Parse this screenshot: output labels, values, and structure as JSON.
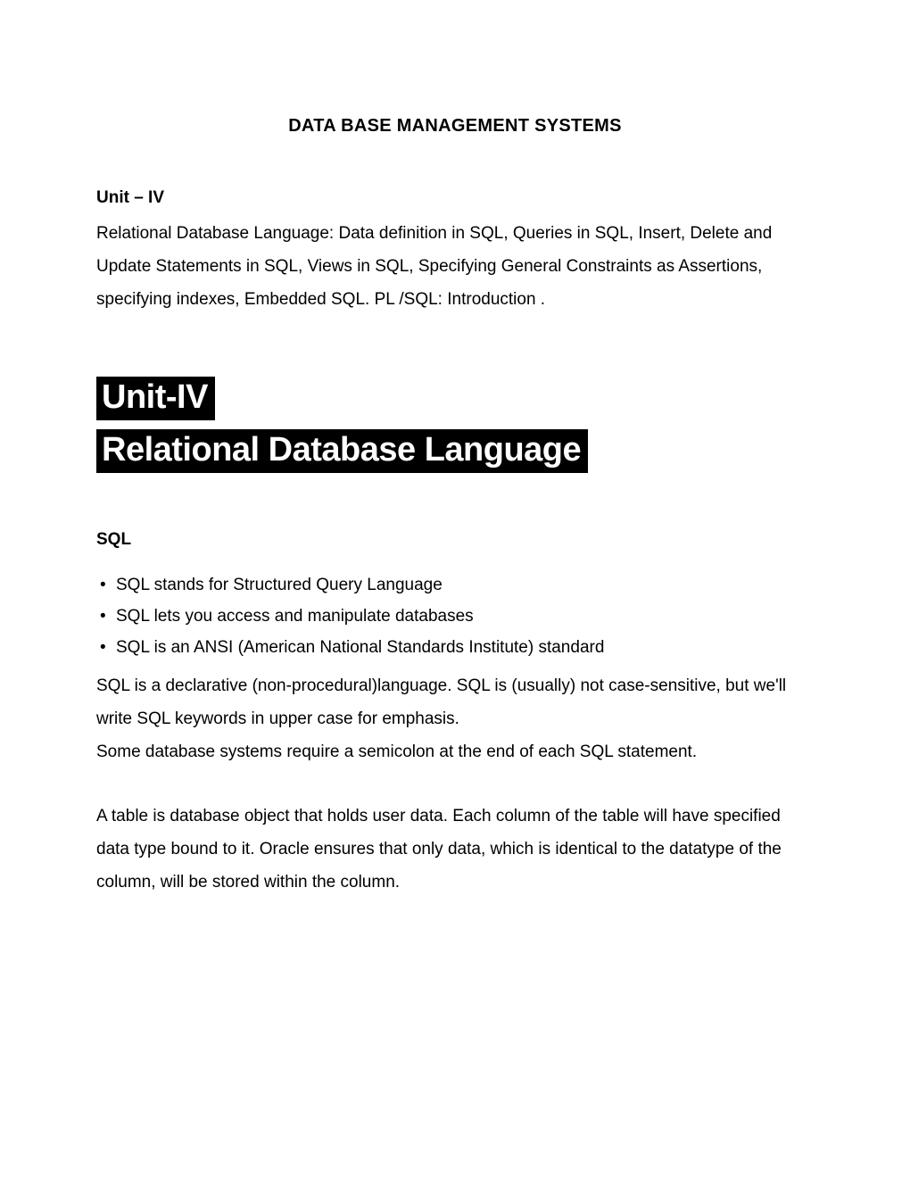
{
  "title": "DATA BASE MANAGEMENT SYSTEMS",
  "unit_label": "Unit – IV",
  "syllabus": "Relational Database Language: Data definition in SQL, Queries in SQL, Insert, Delete and Update Statements in SQL, Views in SQL, Specifying General Constraints as Assertions, specifying indexes, Embedded SQL. PL /SQL: Introduction .",
  "heading1": "Unit-IV",
  "heading2": "Relational Database Language",
  "sql_heading": "SQL",
  "bullets": [
    "SQL stands for Structured Query Language",
    "SQL lets you access and manipulate databases",
    "SQL is an ANSI (American National Standards Institute) standard"
  ],
  "para1": "SQL is a declarative (non-procedural)language. SQL is (usually) not case-sensitive, but we'll write SQL keywords in upper case for emphasis.",
  "para2": "Some database systems require a semicolon at the end of each SQL statement.",
  "para3": "A table is database object that holds user data. Each column of the table will have specified data type bound to it. Oracle ensures that only data, which is identical to the datatype of the column, will be stored within the column."
}
